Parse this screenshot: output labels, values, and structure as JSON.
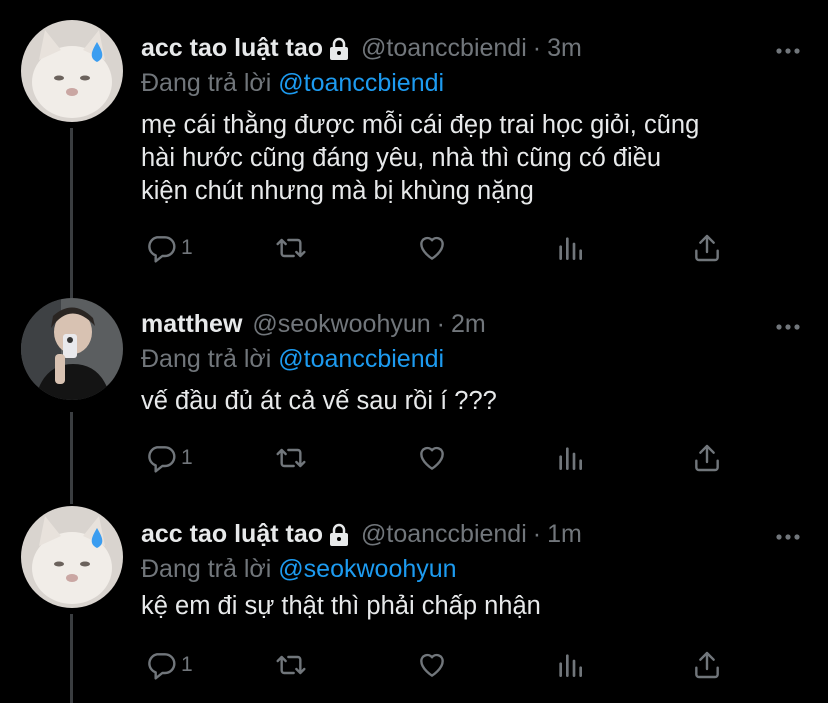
{
  "tweets": [
    {
      "name": "acc tao luật tao",
      "locked": true,
      "handle": "@toanccbiendi",
      "separator": "·",
      "time": "3m",
      "replying_prefix": "Đang trả lời",
      "replying_to": "@toanccbiendi",
      "text_lines": [
        "mẹ cái thằng được mỗi cái đẹp trai học giỏi, cũng",
        "hài hước cũng đáng yêu, nhà thì cũng có điều",
        "kiện chút nhưng mà bị khùng nặng"
      ],
      "reply_count": "1",
      "avatar_icon": "cat-crying-avatar"
    },
    {
      "name": "matthew",
      "locked": false,
      "handle": "@seokwoohyun",
      "separator": "·",
      "time": "2m",
      "replying_prefix": "Đang trả lời",
      "replying_to": "@toanccbiendi",
      "text_lines": [
        "vế đầu đủ át cả vế sau rồi í ???"
      ],
      "reply_count": "1",
      "avatar_icon": "mirror-selfie-avatar"
    },
    {
      "name": "acc tao luật tao",
      "locked": true,
      "handle": "@toanccbiendi",
      "separator": "·",
      "time": "1m",
      "replying_prefix": "Đang trả lời",
      "replying_to": "@seokwoohyun",
      "text_lines": [
        "kệ em đi sự thật thì phải chấp nhận"
      ],
      "reply_count": "1",
      "avatar_icon": "cat-crying-avatar"
    }
  ],
  "icons": {
    "reply": "reply-icon",
    "retweet": "retweet-icon",
    "like": "heart-icon",
    "views": "views-icon",
    "share": "share-icon",
    "more": "more-icon",
    "lock": "lock-icon"
  },
  "colors": {
    "background": "#000000",
    "text": "#e7e9ea",
    "muted": "#71767b",
    "accent": "#1d9bf0"
  }
}
